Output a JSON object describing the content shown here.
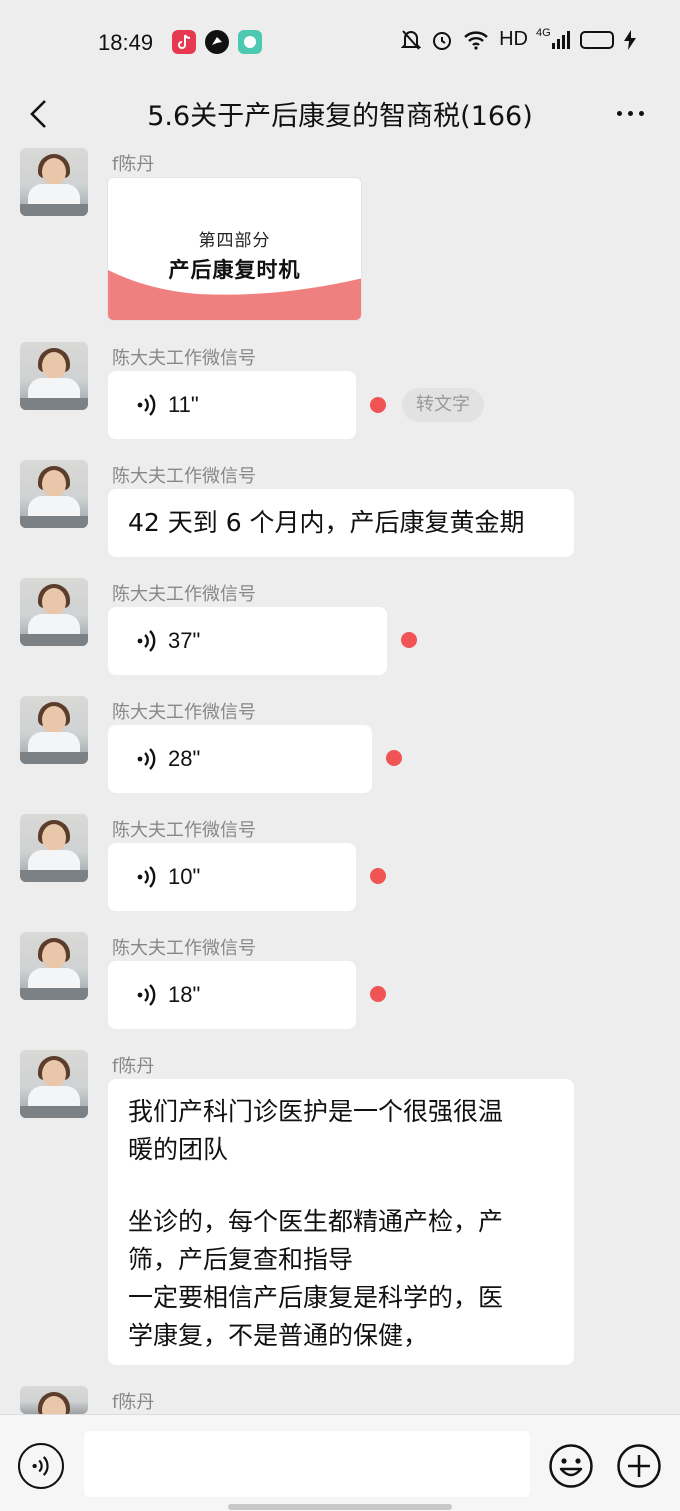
{
  "status_bar": {
    "time": "18:49",
    "hd": "HD",
    "network": "4G",
    "battery_level": 0.8,
    "icons": [
      "tiktok-icon",
      "app-icon",
      "app-icon",
      "mute-icon",
      "alarm-icon",
      "wifi-icon",
      "signal-icon",
      "battery-icon",
      "charging-icon"
    ]
  },
  "header": {
    "title": "5.6关于产后康复的智商税(166)"
  },
  "messages": [
    {
      "sender": "f陈丹",
      "type": "image",
      "image_small_text": "第四部分",
      "image_big_text": "产后康复时机"
    },
    {
      "sender": "陈大夫工作微信号",
      "type": "voice",
      "duration": "11\"",
      "unread": true,
      "to_text_label": "转文字"
    },
    {
      "sender": "陈大夫工作微信号",
      "type": "text",
      "text": "42 天到 6 个月内，产后康复黄金期"
    },
    {
      "sender": "陈大夫工作微信号",
      "type": "voice",
      "duration": "37\"",
      "unread": true
    },
    {
      "sender": "陈大夫工作微信号",
      "type": "voice",
      "duration": "28\"",
      "unread": true
    },
    {
      "sender": "陈大夫工作微信号",
      "type": "voice",
      "duration": "10\"",
      "unread": true
    },
    {
      "sender": "陈大夫工作微信号",
      "type": "voice",
      "duration": "18\"",
      "unread": true
    },
    {
      "sender": "f陈丹",
      "type": "text",
      "lines": [
        "我们产科门诊医护是一个很强很温",
        "暖的团队",
        "",
        "坐诊的，每个医生都精通产检，产",
        "筛，产后复查和指导",
        "一定要相信产后康复是科学的，医",
        "学康复，不是普通的保健，"
      ]
    },
    {
      "sender": "f陈丹",
      "type": "partial"
    }
  ],
  "input_bar": {
    "placeholder": ""
  },
  "colors": {
    "background": "#ededed",
    "bubble": "#ffffff",
    "unread_dot": "#f05454",
    "battery": "#f3c316"
  }
}
